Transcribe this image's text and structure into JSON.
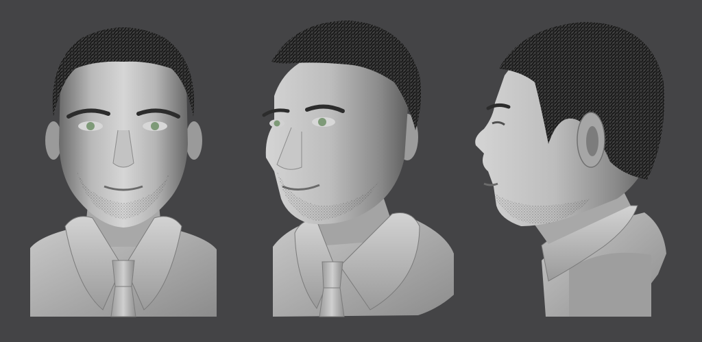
{
  "scene": {
    "subject": "sculpted-male-bust",
    "views": [
      {
        "id": "front",
        "name": "front-view"
      },
      {
        "id": "three-quarter",
        "name": "three-quarter-view"
      },
      {
        "id": "profile",
        "name": "profile-view"
      }
    ],
    "colors": {
      "background": "#444446",
      "clay_light": "#d8d8d8",
      "clay_mid": "#a9a9a9",
      "clay_dark": "#5f5f5f",
      "hair": "#1a1a1a",
      "iris": "#7e9a78"
    }
  }
}
